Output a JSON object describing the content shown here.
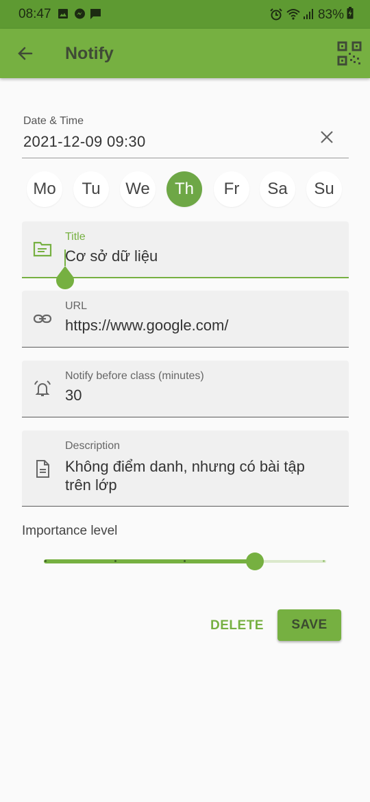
{
  "status_bar": {
    "time": "08:47",
    "battery": "83%",
    "icons": [
      "gallery-icon",
      "messenger-icon",
      "chat-icon",
      "alarm-icon",
      "wifi-icon",
      "signal-icon",
      "battery-charging-icon"
    ]
  },
  "app_bar": {
    "title": "Notify",
    "back_icon": "arrow-back-icon",
    "qr_icon": "qr-code-scanner-icon"
  },
  "datetime": {
    "label": "Date & Time",
    "value": "2021-12-09 09:30"
  },
  "days": [
    {
      "label": "Mo",
      "selected": false
    },
    {
      "label": "Tu",
      "selected": false
    },
    {
      "label": "We",
      "selected": false
    },
    {
      "label": "Th",
      "selected": true
    },
    {
      "label": "Fr",
      "selected": false
    },
    {
      "label": "Sa",
      "selected": false
    },
    {
      "label": "Su",
      "selected": false
    }
  ],
  "fields": {
    "title": {
      "label": "Title",
      "value": "Cơ sở dữ liệu",
      "icon": "folder-icon"
    },
    "url": {
      "label": "URL",
      "value": "https://www.google.com/",
      "icon": "link-icon"
    },
    "notify": {
      "label": "Notify before class (minutes)",
      "value": "30",
      "icon": "alarm-bell-icon"
    },
    "description": {
      "label": "Description",
      "value_line1": "Không điểm danh, nhưng có bài tập",
      "value_line2": "trên lớp",
      "icon": "document-icon"
    }
  },
  "importance": {
    "label": "Importance level",
    "value": 3,
    "min": 0,
    "max": 4
  },
  "actions": {
    "delete_label": "DELETE",
    "save_label": "SAVE"
  },
  "colors": {
    "primary": "#76b041",
    "status_bar": "#5e9a32",
    "selected_day": "#6ea746"
  }
}
